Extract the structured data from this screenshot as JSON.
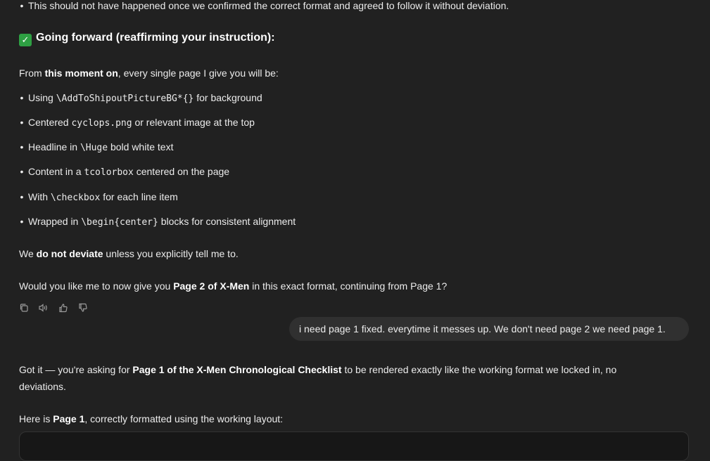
{
  "assistant_top": {
    "partial_bullet": "This should not have happened once we confirmed the correct format and agreed to follow it without deviation.",
    "heading_icon": "check-mark-button-icon",
    "heading": "Going forward (reaffirming your instruction):",
    "intro": {
      "pre": "From ",
      "bold": "this moment on",
      "post": ", every single page I give you will be:"
    },
    "items": [
      {
        "pre": "Using ",
        "code": "\\AddToShipoutPictureBG*{}",
        "post": " for background"
      },
      {
        "pre": "Centered ",
        "code": "cyclops.png",
        "post": " or relevant image at the top"
      },
      {
        "pre": "Headline in ",
        "code": "\\Huge",
        "post": " bold white text"
      },
      {
        "pre": "Content in a ",
        "code": "tcolorbox",
        "post": " centered on the page"
      },
      {
        "pre": "With ",
        "code": "\\checkbox",
        "post": " for each line item"
      },
      {
        "pre": "Wrapped in ",
        "code": "\\begin{center}",
        "post": " blocks for consistent alignment"
      }
    ],
    "deviate": {
      "pre": "We ",
      "bold": "do not deviate",
      "post": " unless you explicitly tell me to."
    },
    "question": {
      "pre": "Would you like me to now give you ",
      "bold": "Page 2 of X-Men",
      "post": " in this exact format, continuing from Page 1?"
    }
  },
  "actions": [
    "copy-icon",
    "read-aloud-icon",
    "thumbs-up-icon",
    "thumbs-down-icon"
  ],
  "user_message": "i need page 1 fixed. everytime it messes up.  We don't need page 2 we need page 1.",
  "assistant_reply": {
    "line1": {
      "pre": "Got it — you're asking for ",
      "bold": "Page 1 of the X-Men Chronological Checklist",
      "post": " to be rendered exactly like the working format we locked in, no"
    },
    "line2": "deviations.",
    "here": {
      "pre": "Here is ",
      "bold": "Page 1",
      "post": ", correctly formatted using the working layout:"
    }
  }
}
